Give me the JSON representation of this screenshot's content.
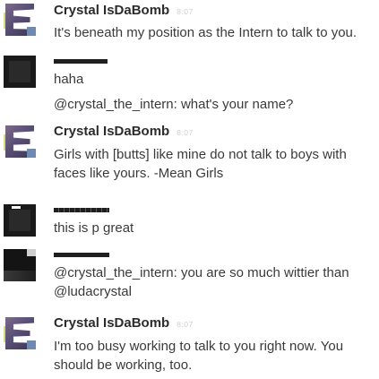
{
  "messages": [
    {
      "author": "Crystal IsDaBomb",
      "time": "8:07",
      "lines": [
        "It's beneath my position as the Intern to talk to you."
      ]
    },
    {
      "author": "",
      "time": "",
      "lines": [
        "haha"
      ]
    },
    {
      "author": "",
      "time": "",
      "lines": [
        "@crystal_the_intern: what's your name?"
      ]
    },
    {
      "author": "Crystal IsDaBomb",
      "time": "8:07",
      "lines": [
        "Girls with [butts] like mine do not talk to boys with",
        "faces like yours. -Mean Girls"
      ]
    },
    {
      "author": "",
      "time": "",
      "lines": [
        "this is p great"
      ]
    },
    {
      "author": "",
      "time": "",
      "lines": [
        "@crystal_the_intern: you are so much wittier than",
        "@ludacrystal"
      ]
    },
    {
      "author": "Crystal IsDaBomb",
      "time": "8:07",
      "lines": [
        "I'm too busy working to talk to you right now. You",
        "should be working, too."
      ]
    }
  ]
}
